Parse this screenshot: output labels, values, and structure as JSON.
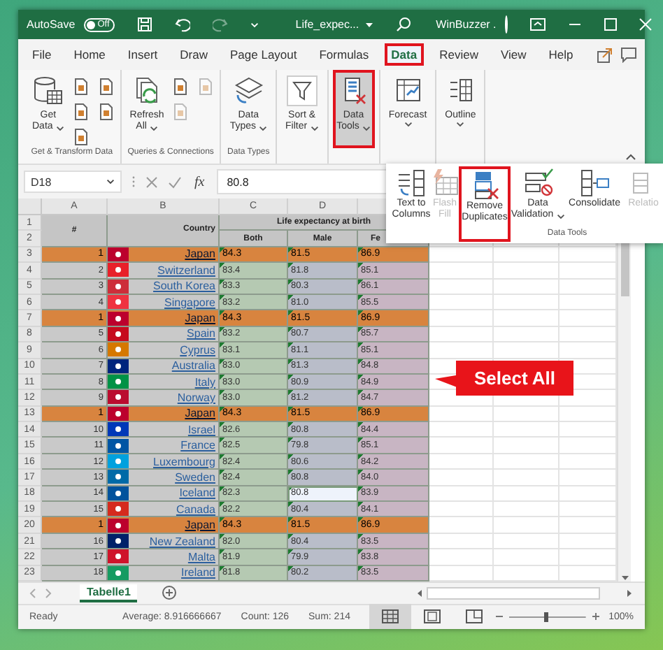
{
  "title_bar": {
    "autosave_label": "AutoSave",
    "autosave_state": "Off",
    "autosave_on": false,
    "redo_disabled": true,
    "file_name": "Life_expec...",
    "user_name": "WinBuzzer ."
  },
  "ribbon_tabs": [
    {
      "label": "File",
      "selected": false,
      "highlighted": false
    },
    {
      "label": "Home",
      "selected": false,
      "highlighted": false
    },
    {
      "label": "Insert",
      "selected": false,
      "highlighted": false
    },
    {
      "label": "Draw",
      "selected": false,
      "highlighted": false
    },
    {
      "label": "Page Layout",
      "selected": false,
      "highlighted": false
    },
    {
      "label": "Formulas",
      "selected": false,
      "highlighted": false
    },
    {
      "label": "Data",
      "selected": true,
      "highlighted": true
    },
    {
      "label": "Review",
      "selected": false,
      "highlighted": false
    },
    {
      "label": "View",
      "selected": false,
      "highlighted": false
    },
    {
      "label": "Help",
      "selected": false,
      "highlighted": false
    }
  ],
  "ribbon_groups": [
    {
      "label": "Get & Transform Data",
      "buttons": [
        {
          "kind": "large",
          "lines": [
            "Get",
            "Data"
          ],
          "caret": true,
          "pressed": false,
          "highlighted": false
        },
        {
          "kind": "small",
          "disabled": false
        },
        {
          "kind": "small",
          "disabled": false
        },
        {
          "kind": "small",
          "disabled": false
        },
        {
          "kind": "small",
          "disabled": false
        },
        {
          "kind": "small",
          "disabled": false
        }
      ]
    },
    {
      "label": "Queries & Connections",
      "buttons": [
        {
          "kind": "large",
          "lines": [
            "Refresh",
            "All"
          ],
          "caret": true,
          "pressed": false,
          "highlighted": false
        },
        {
          "kind": "small",
          "disabled": false
        },
        {
          "kind": "small",
          "disabled": true
        },
        {
          "kind": "small",
          "disabled": true
        }
      ]
    },
    {
      "label": "Data Types",
      "buttons": [
        {
          "kind": "large",
          "lines": [
            "Data",
            "Types"
          ],
          "caret": true,
          "pressed": false,
          "highlighted": false
        }
      ]
    },
    {
      "buttons": [
        {
          "kind": "large",
          "lines": [
            "Sort &",
            "Filter"
          ],
          "caret": true,
          "pressed": false,
          "highlighted": false
        }
      ]
    },
    {
      "buttons": [
        {
          "kind": "large",
          "lines": [
            "Data",
            "Tools"
          ],
          "caret": true,
          "pressed": true,
          "highlighted": true
        }
      ]
    },
    {
      "buttons": [
        {
          "kind": "large",
          "lines": [
            "Forecast"
          ],
          "caret": true,
          "pressed": false,
          "highlighted": false
        }
      ]
    },
    {
      "buttons": [
        {
          "kind": "large",
          "lines": [
            "Outline"
          ],
          "caret": true,
          "pressed": false,
          "highlighted": false
        }
      ]
    }
  ],
  "data_tools_menu": {
    "label": "Data Tools",
    "buttons": [
      {
        "lines": [
          "Text to",
          "Columns"
        ],
        "caret": false,
        "disabled": false,
        "highlighted": false
      },
      {
        "lines": [
          "Flash",
          "Fill"
        ],
        "caret": false,
        "disabled": true,
        "highlighted": false
      },
      {
        "lines": [
          "Remove",
          "Duplicates"
        ],
        "caret": false,
        "disabled": false,
        "highlighted": true
      },
      {
        "lines": [
          "Data",
          "Validation"
        ],
        "caret": true,
        "disabled": false,
        "highlighted": false
      },
      {
        "lines": [
          "Consolidate"
        ],
        "caret": false,
        "disabled": false,
        "highlighted": false
      },
      {
        "lines": [
          "Relatio"
        ],
        "caret": false,
        "disabled": true,
        "highlighted": false
      }
    ]
  },
  "formula_bar": {
    "name_box": "D18",
    "function_label": "fx",
    "value": "80.8"
  },
  "sheet": {
    "columns": [
      "A",
      "B",
      "C",
      "D"
    ],
    "header": {
      "rows": [
        "1",
        "2"
      ],
      "number": "#",
      "country": "Country",
      "group": "Life expectancy at birth",
      "both": "Both",
      "male": "Male",
      "female": "Fe"
    },
    "rows": [
      {
        "row": "3",
        "num": "1",
        "country": "Japan",
        "color": "#bc002d",
        "both": "84.3",
        "male": "81.5",
        "female": "86.9",
        "highlighted": true,
        "male_cell_selected": false
      },
      {
        "row": "4",
        "num": "2",
        "country": "Switzerland",
        "color": "#e8202a",
        "both": "83.4",
        "male": "81.8",
        "female": "85.1",
        "highlighted": false,
        "male_cell_selected": false
      },
      {
        "row": "5",
        "num": "3",
        "country": "South Korea",
        "color": "#cd2e3a",
        "both": "83.3",
        "male": "80.3",
        "female": "86.1",
        "highlighted": false,
        "male_cell_selected": false
      },
      {
        "row": "6",
        "num": "4",
        "country": "Singapore",
        "color": "#ef3340",
        "both": "83.2",
        "male": "81.0",
        "female": "85.5",
        "highlighted": false,
        "male_cell_selected": false
      },
      {
        "row": "7",
        "num": "1",
        "country": "Japan",
        "color": "#bc002d",
        "both": "84.3",
        "male": "81.5",
        "female": "86.9",
        "highlighted": true,
        "male_cell_selected": false
      },
      {
        "row": "8",
        "num": "5",
        "country": "Spain",
        "color": "#c60b1e",
        "both": "83.2",
        "male": "80.7",
        "female": "85.7",
        "highlighted": false,
        "male_cell_selected": false
      },
      {
        "row": "9",
        "num": "6",
        "country": "Cyprus",
        "color": "#d57800",
        "both": "83.1",
        "male": "81.1",
        "female": "85.1",
        "highlighted": false,
        "male_cell_selected": false
      },
      {
        "row": "10",
        "num": "7",
        "country": "Australia",
        "color": "#00247d",
        "both": "83.0",
        "male": "81.3",
        "female": "84.8",
        "highlighted": false,
        "male_cell_selected": false
      },
      {
        "row": "11",
        "num": "8",
        "country": "Italy",
        "color": "#009246",
        "both": "83.0",
        "male": "80.9",
        "female": "84.9",
        "highlighted": false,
        "male_cell_selected": false
      },
      {
        "row": "12",
        "num": "9",
        "country": "Norway",
        "color": "#ba0c2f",
        "both": "83.0",
        "male": "81.2",
        "female": "84.7",
        "highlighted": false,
        "male_cell_selected": false
      },
      {
        "row": "13",
        "num": "1",
        "country": "Japan",
        "color": "#bc002d",
        "both": "84.3",
        "male": "81.5",
        "female": "86.9",
        "highlighted": true,
        "male_cell_selected": false
      },
      {
        "row": "14",
        "num": "10",
        "country": "Israel",
        "color": "#0038b8",
        "both": "82.6",
        "male": "80.8",
        "female": "84.4",
        "highlighted": false,
        "male_cell_selected": false
      },
      {
        "row": "15",
        "num": "11",
        "country": "France",
        "color": "#0055a4",
        "both": "82.5",
        "male": "79.8",
        "female": "85.1",
        "highlighted": false,
        "male_cell_selected": false
      },
      {
        "row": "16",
        "num": "12",
        "country": "Luxembourg",
        "color": "#00a1de",
        "both": "82.4",
        "male": "80.6",
        "female": "84.2",
        "highlighted": false,
        "male_cell_selected": false
      },
      {
        "row": "17",
        "num": "13",
        "country": "Sweden",
        "color": "#006aa7",
        "both": "82.4",
        "male": "80.8",
        "female": "84.0",
        "highlighted": false,
        "male_cell_selected": false
      },
      {
        "row": "18",
        "num": "14",
        "country": "Iceland",
        "color": "#02529c",
        "both": "82.3",
        "male": "80.8",
        "female": "83.9",
        "highlighted": false,
        "male_cell_selected": true
      },
      {
        "row": "19",
        "num": "15",
        "country": "Canada",
        "color": "#d52b1e",
        "both": "82.2",
        "male": "80.4",
        "female": "84.1",
        "highlighted": false,
        "male_cell_selected": false
      },
      {
        "row": "20",
        "num": "1",
        "country": "Japan",
        "color": "#bc002d",
        "both": "84.3",
        "male": "81.5",
        "female": "86.9",
        "highlighted": true,
        "male_cell_selected": false
      },
      {
        "row": "21",
        "num": "16",
        "country": "New Zealand",
        "color": "#012169",
        "both": "82.0",
        "male": "80.4",
        "female": "83.5",
        "highlighted": false,
        "male_cell_selected": false
      },
      {
        "row": "22",
        "num": "17",
        "country": "Malta",
        "color": "#cf142b",
        "both": "81.9",
        "male": "79.9",
        "female": "83.8",
        "highlighted": false,
        "male_cell_selected": false
      },
      {
        "row": "23",
        "num": "18",
        "country": "Ireland",
        "color": "#169b62",
        "both": "81.8",
        "male": "80.2",
        "female": "83.5",
        "highlighted": false,
        "male_cell_selected": false
      }
    ]
  },
  "sheet_tabs": [
    {
      "label": "Tabelle1",
      "selected": true
    }
  ],
  "status_bar": {
    "status": "Ready",
    "average": "Average: 8.916666667",
    "count": "Count: 126",
    "sum": "Sum: 214",
    "views": [
      {
        "kind": "normal",
        "selected": true
      },
      {
        "kind": "page_layout",
        "selected": false
      },
      {
        "kind": "page_break",
        "selected": false
      }
    ],
    "zoom_slider": {
      "level": 0.47
    },
    "zoom": "100%"
  },
  "callout": {
    "text": "Select All"
  }
}
